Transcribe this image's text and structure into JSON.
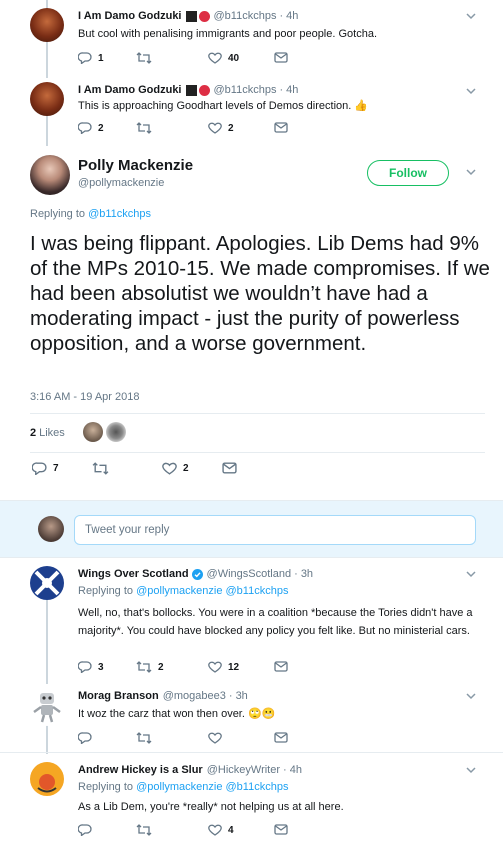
{
  "tweet1": {
    "name": "I Am Damo Godzuki",
    "handle": "@b11ckchps",
    "time": "· 4h",
    "text": "But cool with penalising immigrants and poor people. Gotcha.",
    "reply_count": "1",
    "retweet_count": "",
    "like_count": "40"
  },
  "tweet2": {
    "name": "I Am Damo Godzuki",
    "handle": "@b11ckchps",
    "time": "· 4h",
    "text": "This is approaching Goodhart levels of Demos direction. 👍",
    "reply_count": "2",
    "retweet_count": "",
    "like_count": "2"
  },
  "main_tweet": {
    "name": "Polly Mackenzie",
    "handle": "@pollymackenzie",
    "follow_label": "Follow",
    "replying_prefix": "Replying to ",
    "replying_to": "@b11ckchps",
    "text": "I was being flippant. Apologies. Lib Dems had 9% of the MPs 2010-15. We made compromises. If we had been absolutist we wouldn’t have had a moderating impact - just the purity of powerless opposition, and a worse government.",
    "timestamp": "3:16 AM - 19 Apr 2018",
    "likes_count": "2",
    "likes_label": "Likes",
    "reply_count": "7",
    "like_count": "2"
  },
  "reply_box": {
    "placeholder": "Tweet your reply"
  },
  "reply1": {
    "name": "Wings Over Scotland",
    "handle": "@WingsScotland",
    "time": "· 3h",
    "replying_prefix": "Replying to ",
    "replying_to": "@pollymackenzie @b11ckchps",
    "text": "Well, no, that's bollocks. You were in a coalition *because the Tories didn't have a majority*. You could have blocked any policy you felt like. But no ministerial cars.",
    "reply_count": "3",
    "retweet_count": "2",
    "like_count": "12"
  },
  "reply2": {
    "name": "Morag Branson",
    "handle": "@mogabee3",
    "time": "· 3h",
    "text": "It woz the carz that won then over. 🙄😬"
  },
  "reply3": {
    "name": "Andrew Hickey is a Slur",
    "handle": "@HickeyWriter",
    "time": "· 4h",
    "replying_prefix": "Replying to ",
    "replying_to": "@pollymackenzie @b11ckchps",
    "text": "As a Lib Dem, you're *really* not helping us at all here.",
    "like_count": "4"
  },
  "colors": {
    "accent": "#1da1f2",
    "follow_green": "#17bf63",
    "muted": "#657786",
    "line": "#ccd6dd"
  }
}
